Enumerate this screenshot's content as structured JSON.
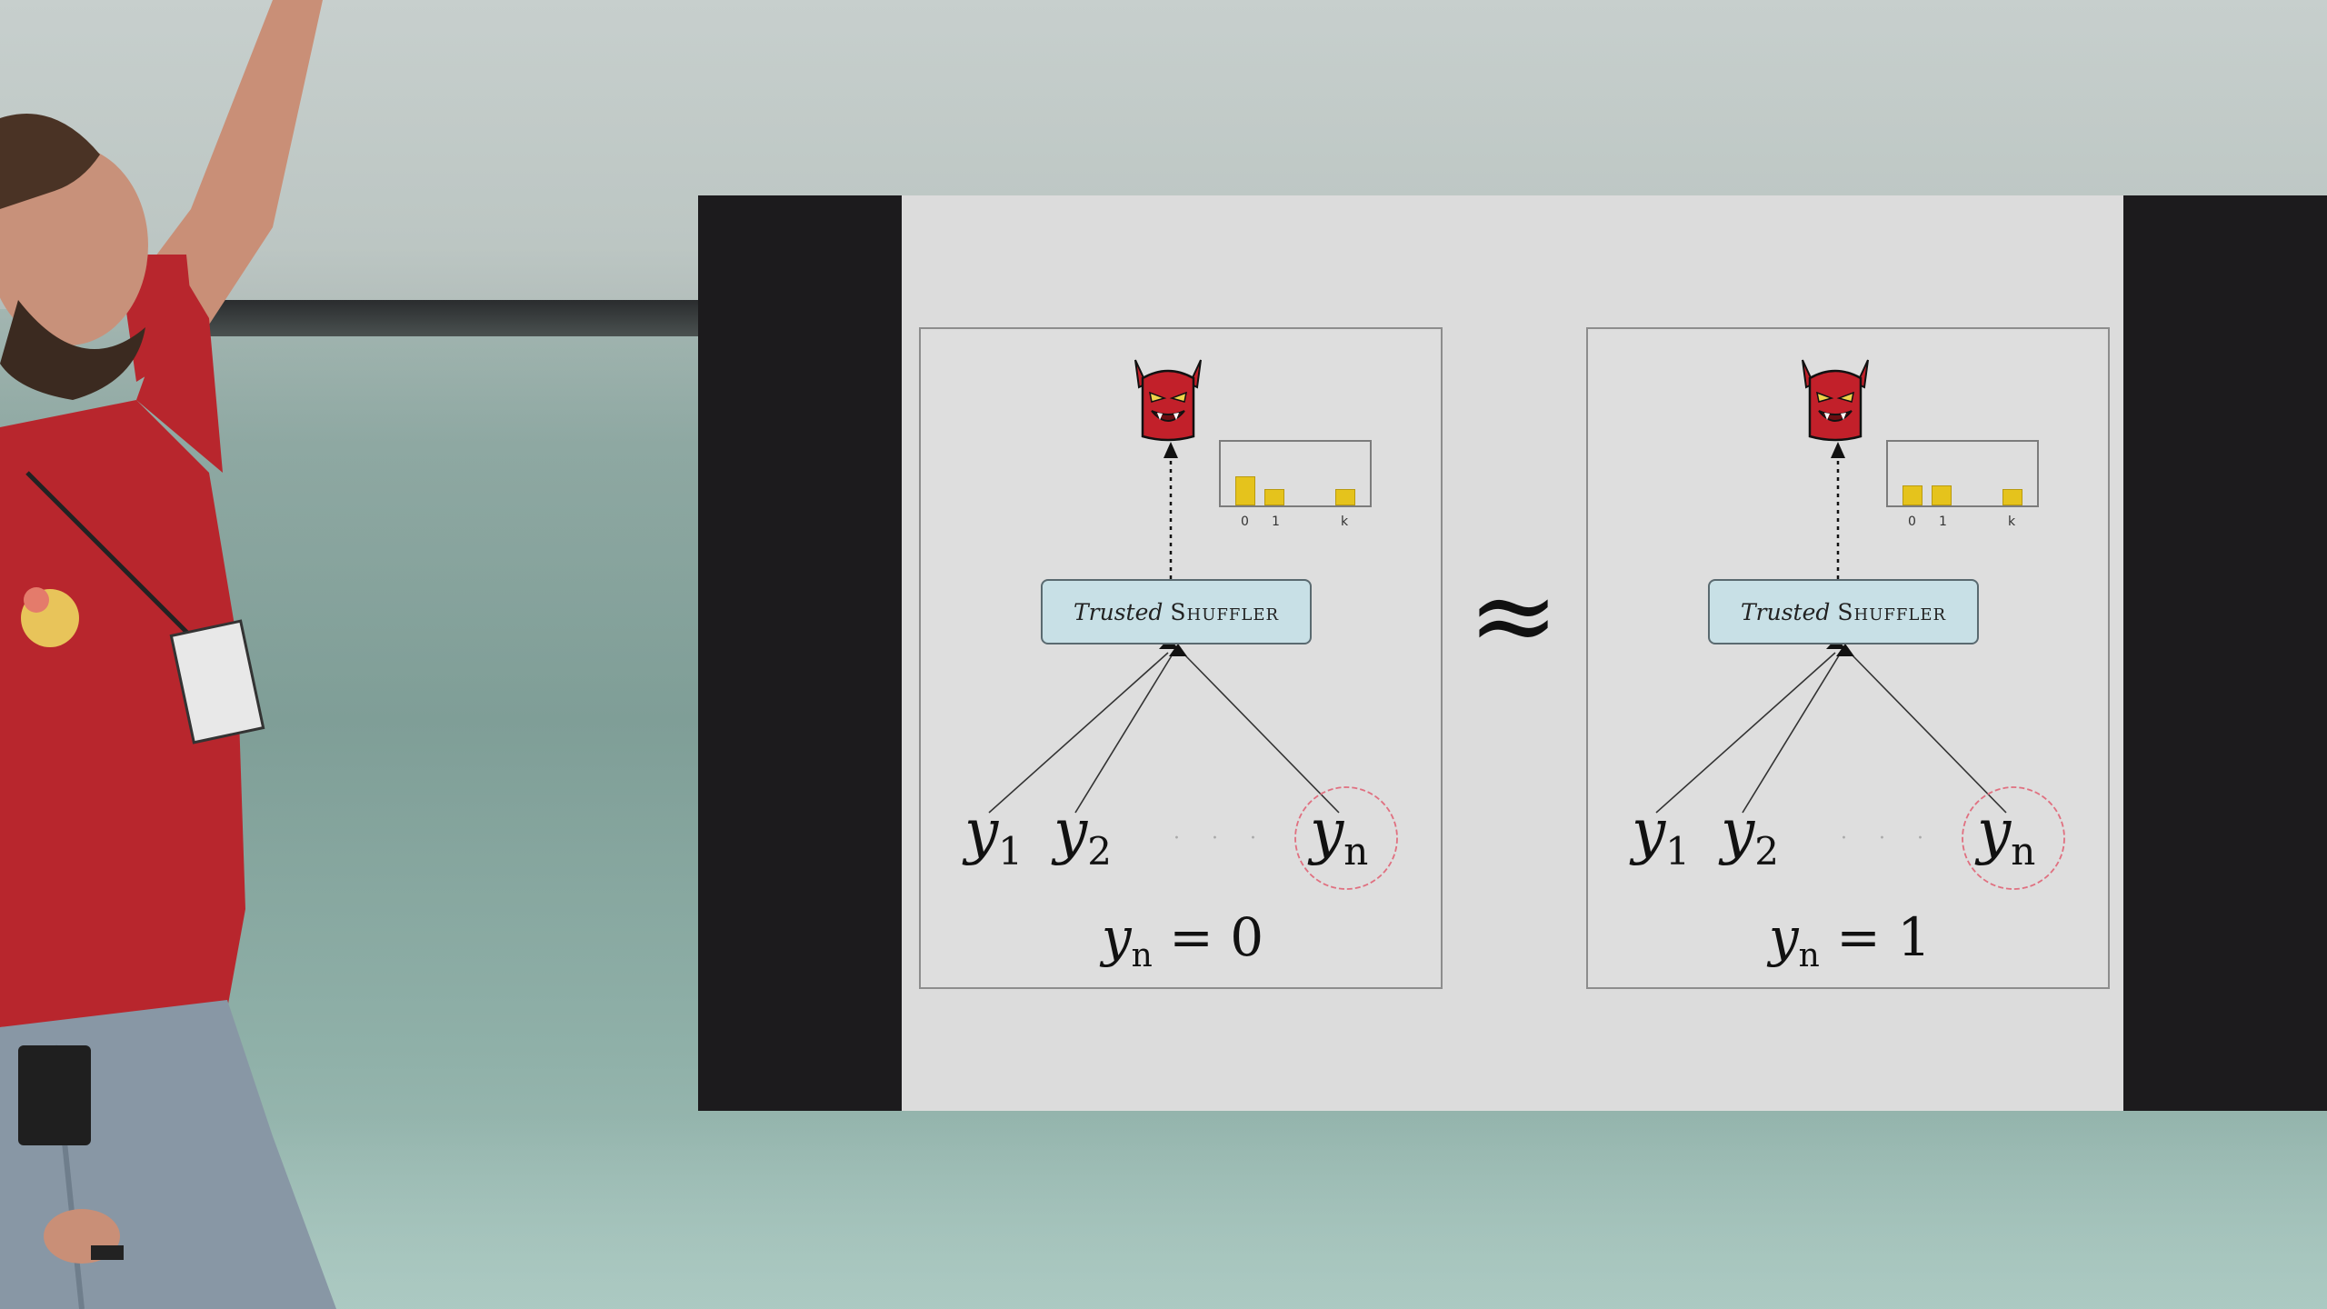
{
  "slide": {
    "approx_symbol": "≈",
    "panels": [
      {
        "shuffler_italic": "Trusted",
        "shuffler_caps": "Shuffler",
        "hist_ticks": [
          "0",
          "1",
          "k"
        ],
        "y1": "y",
        "y1_sub": "1",
        "y2": "y",
        "y2_sub": "2",
        "dots": "· · ·",
        "yn": "y",
        "yn_sub": "n",
        "eq_var": "y",
        "eq_sub": "n",
        "eq_rest": " = 0"
      },
      {
        "shuffler_italic": "Trusted",
        "shuffler_caps": "Shuffler",
        "hist_ticks": [
          "0",
          "1",
          "k"
        ],
        "y1": "y",
        "y1_sub": "1",
        "y2": "y",
        "y2_sub": "2",
        "dots": "· · ·",
        "yn": "y",
        "yn_sub": "n",
        "eq_var": "y",
        "eq_sub": "n",
        "eq_rest": " = 1"
      }
    ]
  },
  "colors": {
    "devil": "#c2202a",
    "shuffler_fill": "#c8e0e6",
    "hist_bar": "#e5c31c",
    "circle": "#e07080",
    "projection_border": "#1c1b1d"
  },
  "icons": [
    "devil-adversary-icon",
    "histogram-icon"
  ]
}
